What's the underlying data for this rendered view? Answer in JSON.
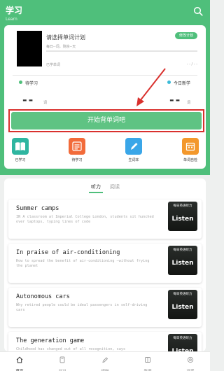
{
  "header": {
    "title": "学习",
    "subtitle": "Learn"
  },
  "plan": {
    "title": "请选择单词计划",
    "sub": "每日--词，剩余--天",
    "change_label": "修改计划",
    "learned": "已学单词",
    "progress_text": "- - / - -"
  },
  "stats": {
    "pending_label": "待学习",
    "today_label": "今日新学",
    "pending_value": "--",
    "pending_unit": "词",
    "today_value": "--",
    "today_unit": "词",
    "pending_color": "#4fbf7b",
    "today_color": "#3bbbd8"
  },
  "start_label": "开始背单词吧",
  "shortcuts": [
    {
      "label": "已学习",
      "icon": "book-icon",
      "color": "#2fb5a0"
    },
    {
      "label": "待学习",
      "icon": "list-icon",
      "color": "#f26b3a"
    },
    {
      "label": "生词本",
      "icon": "pen-icon",
      "color": "#3aa6e8"
    },
    {
      "label": "单词自检",
      "icon": "calendar-icon",
      "color": "#f3982c"
    }
  ],
  "tabs": [
    {
      "label": "听力"
    },
    {
      "label": "阅读"
    }
  ],
  "articles": [
    {
      "title": "Summer camps",
      "desc": "IN A classroom at Imperial College London, students sit hunched over laptops, typing lines of code",
      "badge": "每日英语听力",
      "thumb_label": "Listen"
    },
    {
      "title": "In praise of air-conditioning",
      "desc": "How to spread the benefit of air-conditioning —without frying the planet",
      "badge": "每日英语听力",
      "thumb_label": "Listen"
    },
    {
      "title": "Autonomous cars",
      "desc": "Why retired people could be ideal passengers in self-driving cars",
      "badge": "每日英语听力",
      "thumb_label": "Listen"
    },
    {
      "title": "The generation game",
      "desc": "Childhood has changed out of all recognition, says",
      "badge": "每日英语听力",
      "thumb_label": "Listen"
    }
  ],
  "nav": [
    {
      "label": "首页",
      "icon": "home-icon"
    },
    {
      "label": "日记",
      "icon": "diary-icon"
    },
    {
      "label": "编辑",
      "icon": "edit-icon"
    },
    {
      "label": "数据",
      "icon": "data-icon"
    },
    {
      "label": "设置",
      "icon": "settings-icon"
    }
  ]
}
